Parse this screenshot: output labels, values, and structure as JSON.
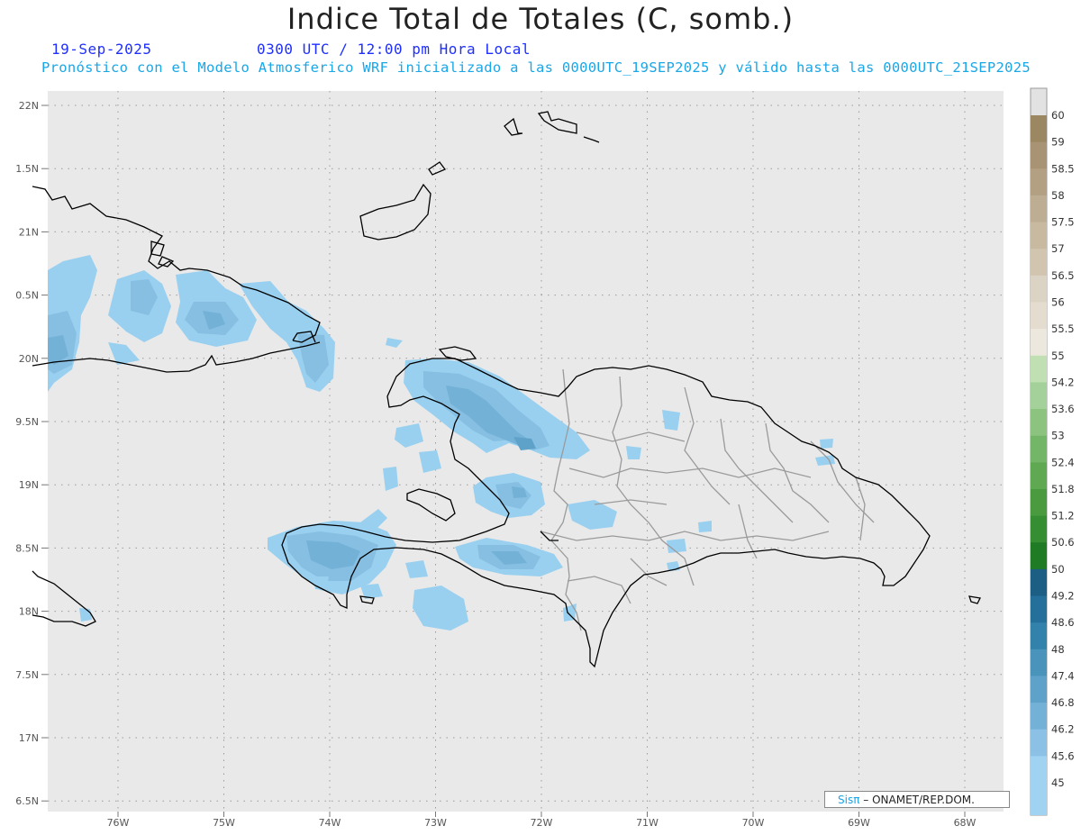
{
  "title": "Indice Total de Totales (C, somb.)",
  "date": "19-Sep-2025",
  "time_text": "0300 UTC / 12:00 pm Hora Local",
  "subtitle": "Pronóstico con el Modelo Atmosferico WRF inicializado a las 0000UTC_19SEP2025 y válido hasta las  0000UTC_21SEP2025",
  "credit": {
    "brand": "Sisπ",
    "text": "– ONAMET/REP.DOM."
  },
  "colors": {
    "ocean": "#e9e9e9",
    "low_fill": "#99d0f0",
    "mid_fill": "#8cc4e6",
    "high_fill": "#6fa9cf",
    "coast": "#000000",
    "borders": "#9a9a9a"
  },
  "chart_data": {
    "type": "map",
    "lat_labels": [
      "22N",
      "1.5N",
      "21N",
      "0.5N",
      "20N",
      "9.5N",
      "19N",
      "8.5N",
      "18N",
      "7.5N",
      "17N",
      "6.5N"
    ],
    "lon_labels": [
      "76W",
      "75W",
      "74W",
      "73W",
      "72W",
      "71W",
      "70W",
      "69W",
      "68W"
    ],
    "lat_range": [
      16.5,
      22
    ],
    "lon_range": [
      -76.7,
      -67.6
    ],
    "grid": "dotted",
    "colorbar": {
      "labels": [
        "60",
        "59",
        "58.5",
        "58",
        "57.5",
        "57",
        "56.5",
        "56",
        "55.5",
        "55",
        "54.2",
        "53.6",
        "53",
        "52.4",
        "51.8",
        "51.2",
        "50.6",
        "50",
        "49.2",
        "48.6",
        "48",
        "47.4",
        "46.8",
        "46.2",
        "45.6",
        "45"
      ],
      "colors": [
        "#e2e2e2",
        "#9b8762",
        "#a89474",
        "#b3a083",
        "#bdad92",
        "#c8baa1",
        "#d1c5b0",
        "#dbd3c3",
        "#e4dccf",
        "#ede8de",
        "#c0e0b4",
        "#a4d199",
        "#8cc47f",
        "#74b667",
        "#5ea951",
        "#4a9b40",
        "#358e32",
        "#207c24",
        "#1c5e84",
        "#25709a",
        "#3282ab",
        "#4a93bb",
        "#5fa2c9",
        "#74b1d7",
        "#8bc1e4",
        "#a0d3f2"
      ]
    }
  }
}
